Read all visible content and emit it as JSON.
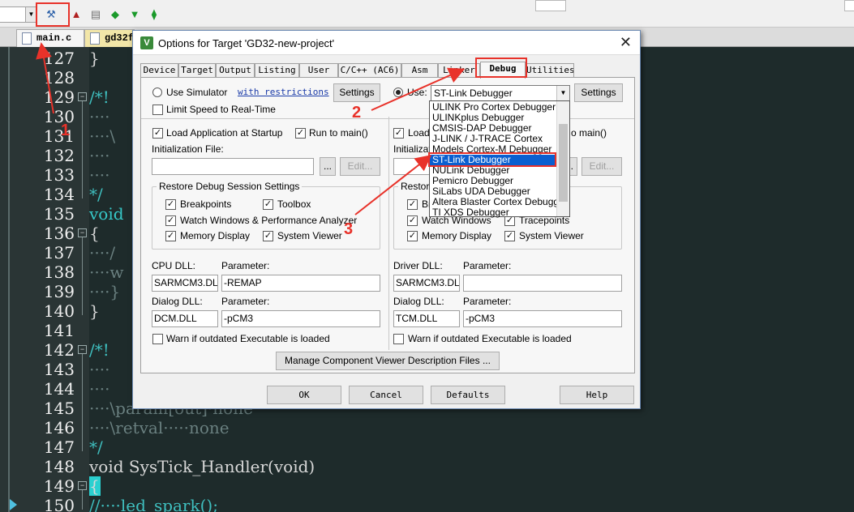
{
  "toolbar": {
    "buttons": [
      {
        "name": "options-for-target-icon",
        "glyph": "⚒"
      },
      {
        "name": "download-icon",
        "glyph": "▲"
      },
      {
        "name": "manage-icon",
        "glyph": "▤"
      },
      {
        "name": "green-diamond-icon",
        "glyph": "◆"
      },
      {
        "name": "green-down-icon",
        "glyph": "▼"
      },
      {
        "name": "pack-icon",
        "glyph": "⧫"
      }
    ]
  },
  "file_tabs": [
    {
      "label": "main.c"
    },
    {
      "label": "gd32f"
    }
  ],
  "editor": {
    "line_numbers": [
      "127",
      "128",
      "129",
      "130",
      "131",
      "132",
      "133",
      "134",
      "135",
      "136",
      "137",
      "138",
      "139",
      "140",
      "141",
      "142",
      "143",
      "144",
      "145",
      "146",
      "147",
      "148",
      "149",
      "150"
    ],
    "lines": [
      {
        "text": "}",
        "cls": "fn"
      },
      {
        "text": "",
        "cls": "fn"
      },
      {
        "text": "/*!",
        "cls": "cm"
      },
      {
        "text": "····",
        "cls": "dim"
      },
      {
        "text": "····\\",
        "cls": "dim"
      },
      {
        "text": "····",
        "cls": "dim"
      },
      {
        "text": "····",
        "cls": "dim"
      },
      {
        "text": "*/",
        "cls": "cm"
      },
      {
        "text": "void",
        "cls": "kw"
      },
      {
        "text": "{",
        "cls": "fn"
      },
      {
        "text": "····/",
        "cls": "dim"
      },
      {
        "text": "····w",
        "cls": "dim"
      },
      {
        "text": "····}",
        "cls": "dim"
      },
      {
        "text": "}",
        "cls": "fn"
      },
      {
        "text": "",
        "cls": "fn"
      },
      {
        "text": "/*!",
        "cls": "cm"
      },
      {
        "text": "····",
        "cls": "dim"
      },
      {
        "text": "····",
        "cls": "dim"
      },
      {
        "text": "····\\param[out]·none",
        "cls": "dim"
      },
      {
        "text": "····\\retval·····none",
        "cls": "dim"
      },
      {
        "text": "*/",
        "cls": "cm"
      },
      {
        "text": "void SysTick_Handler(void)",
        "cls": "fn"
      },
      {
        "text": "{",
        "cls": "fn"
      },
      {
        "text": "//····led_spark();",
        "cls": "cm"
      }
    ]
  },
  "dialog": {
    "title": "Options for Target 'GD32-new-project'",
    "close_glyph": "✕",
    "app_icon_glyph": "V",
    "tabs": [
      "Device",
      "Target",
      "Output",
      "Listing",
      "User",
      "C/C++ (AC6)",
      "Asm",
      "Linker",
      "Debug",
      "Utilities"
    ],
    "active_tab": "Debug",
    "left": {
      "use_simulator": "Use Simulator",
      "with_restrictions": "with restrictions",
      "settings": "Settings",
      "limit_speed": "Limit Speed to Real-Time",
      "load_app": "Load Application at Startup",
      "run_to_main": "Run to main()",
      "init_file": "Initialization File:",
      "browse": "...",
      "edit": "Edit...",
      "restore_title": "Restore Debug Session Settings",
      "breakpoints": "Breakpoints",
      "toolbox": "Toolbox",
      "watch_windows": "Watch Windows & Performance Analyzer",
      "memory_display": "Memory Display",
      "system_viewer": "System Viewer",
      "cpu_dll": "CPU DLL:",
      "parameter": "Parameter:",
      "cpu_dll_value": "SARMCM3.DLL",
      "cpu_param_value": "-REMAP",
      "dialog_dll": "Dialog DLL:",
      "dialog_dll_value": "DCM.DLL",
      "dialog_param_value": "-pCM3",
      "warn": "Warn if outdated Executable is loaded"
    },
    "right": {
      "use": "Use:",
      "selected_debugger": "ST-Link Debugger",
      "settings": "Settings",
      "load": "Load",
      "run_to_main_partial": "o main()",
      "init_partial": "Initializati",
      "browse": "...",
      "edit": "Edit...",
      "restore_partial": "Restore",
      "breakpoints_partial": "Brea",
      "tracepoints": "Tracepoints",
      "watch_windows": "Watch Windows",
      "memory_display": "Memory Display",
      "system_viewer": "System Viewer",
      "driver_dll": "Driver DLL:",
      "parameter": "Parameter:",
      "driver_dll_value": "SARMCM3.DLL",
      "driver_param_value": "",
      "dialog_dll": "Dialog DLL:",
      "dialog_dll_value": "TCM.DLL",
      "dialog_param_value": "-pCM3",
      "warn": "Warn if outdated Executable is loaded"
    },
    "debugger_options": [
      "ULINK Pro Cortex Debugger",
      "ULINKplus Debugger",
      "CMSIS-DAP Debugger",
      "J-LINK / J-TRACE Cortex",
      "Models Cortex-M Debugger",
      "ST-Link Debugger",
      "NULink Debugger",
      "Pemicro Debugger",
      "SiLabs UDA Debugger",
      "Altera Blaster Cortex Debugger",
      "TI XDS Debugger"
    ],
    "manage_btn": "Manage Component Viewer Description Files ...",
    "ok": "OK",
    "cancel": "Cancel",
    "defaults": "Defaults",
    "help": "Help"
  },
  "annotations": {
    "step1": "1",
    "step2": "2",
    "step3": "3",
    "color": "#e8322a"
  }
}
